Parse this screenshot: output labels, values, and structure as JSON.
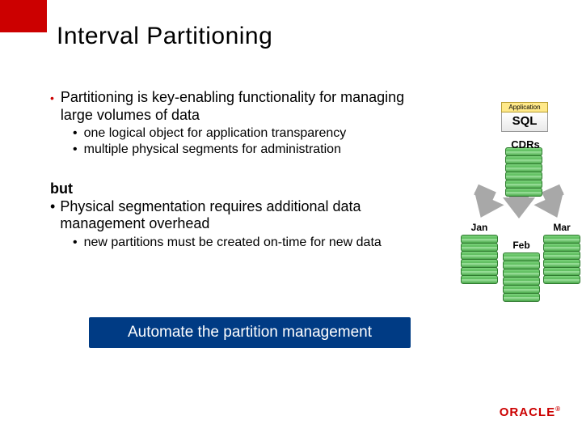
{
  "title": "Interval Partitioning",
  "main_bullet": "Partitioning is key-enabling functionality for managing large volumes of data",
  "sub_bullets": [
    "one logical object for application transparency",
    "multiple physical segments for administration"
  ],
  "but_label": "but",
  "but_point": "Physical segmentation requires additional data management overhead",
  "but_sub": "new partitions must be created on-time for new data",
  "callout": "Automate the partition management",
  "diagram": {
    "app": "Application",
    "sql": "SQL",
    "cdrs": "CDRs",
    "months": [
      "Jan",
      "Feb",
      "Mar"
    ]
  },
  "logo": "ORACLE"
}
